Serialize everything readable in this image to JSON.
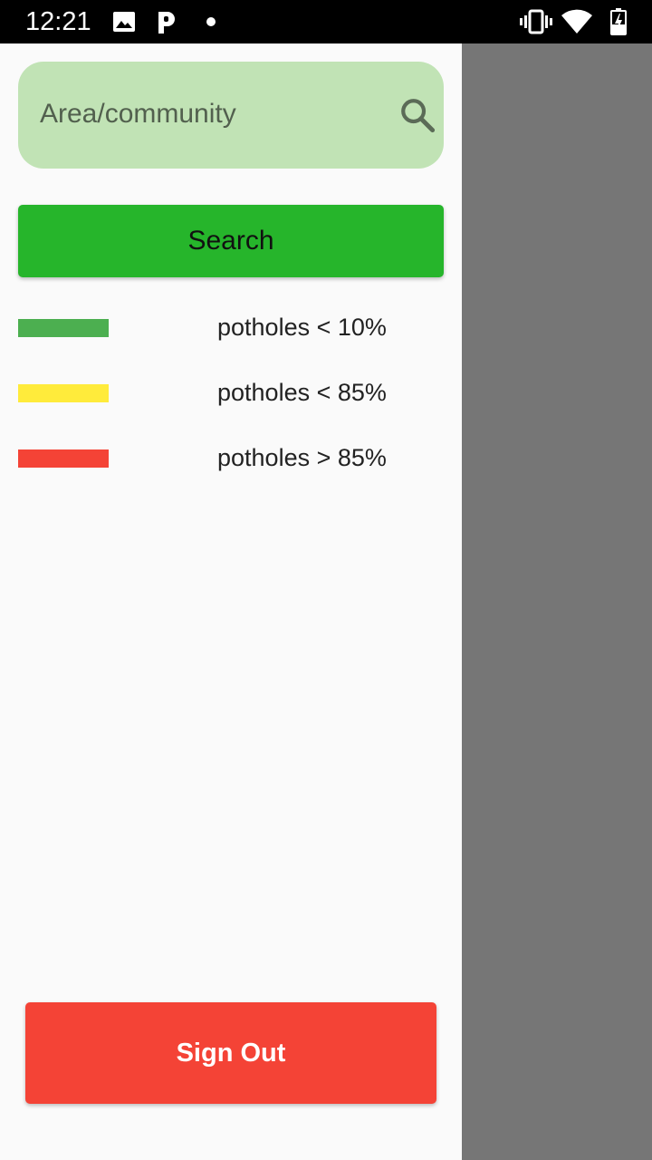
{
  "status_bar": {
    "time": "12:21",
    "icons": [
      "image-icon",
      "p-icon",
      "dot-icon",
      "vibrate-icon",
      "wifi-icon",
      "battery-charging-icon"
    ]
  },
  "drawer": {
    "search": {
      "placeholder": "Area/community",
      "value": "",
      "icon": "search-icon"
    },
    "search_button_label": "Search",
    "legend": [
      {
        "color": "#4caf50",
        "label": "potholes < 10%"
      },
      {
        "color": "#ffeb3b",
        "label": "potholes < 85%"
      },
      {
        "color": "#f44336",
        "label": "potholes > 85%"
      }
    ],
    "sign_out_label": "Sign Out"
  },
  "colors": {
    "search_field_bg": "#c1e3b5",
    "search_button_bg": "#26b52b",
    "sign_out_bg": "#f44336",
    "scrim": "#767676"
  }
}
